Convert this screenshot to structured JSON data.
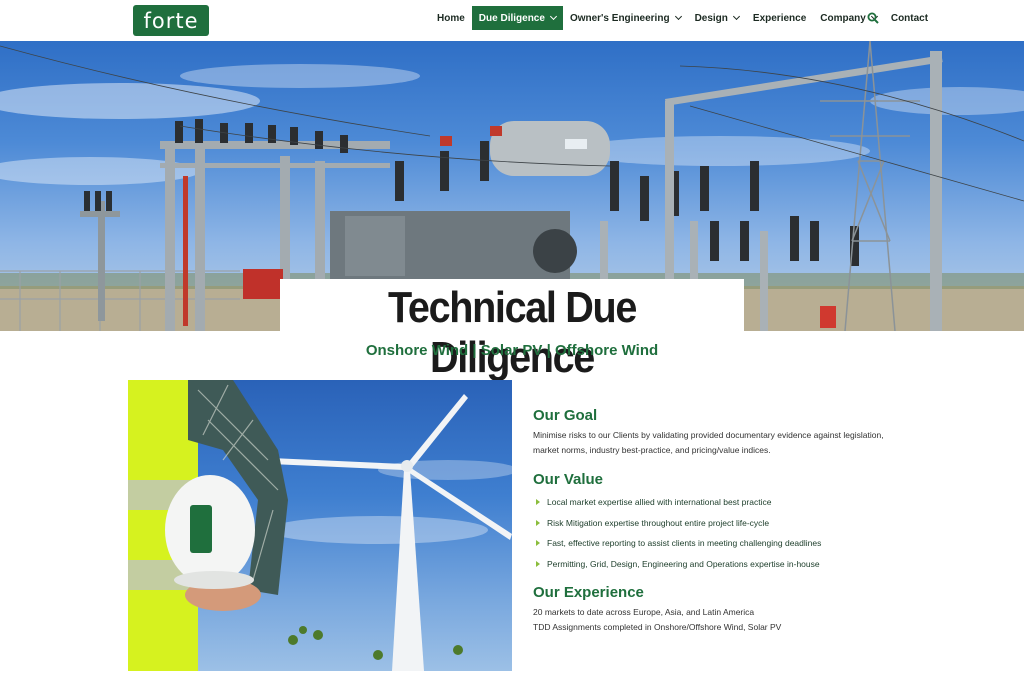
{
  "header": {
    "logo_text": "forte",
    "nav": [
      {
        "label": "Home",
        "dropdown": false,
        "active": false
      },
      {
        "label": "Due Diligence",
        "dropdown": true,
        "active": true
      },
      {
        "label": "Owner's Engineering",
        "dropdown": true,
        "active": false
      },
      {
        "label": "Design",
        "dropdown": true,
        "active": false
      },
      {
        "label": "Experience",
        "dropdown": false,
        "active": false
      },
      {
        "label": "Company",
        "dropdown": true,
        "active": false
      },
      {
        "label": "Contact",
        "dropdown": false,
        "active": false
      }
    ],
    "search_icon": "search-icon"
  },
  "hero": {
    "title": "Technical Due Diligence",
    "subtitle": "Onshore Wind | Solar PV | Offshore Wind",
    "image_subject": "electrical-substation"
  },
  "photo": {
    "image_subject": "worker-holding-helmet-wind-turbine",
    "helmet_logo_text": "forte"
  },
  "sections": {
    "goal": {
      "title": "Our Goal",
      "text": "Minimise risks to our Clients by validating provided documentary evidence against legislation, market norms, industry best-practice, and pricing/value indices."
    },
    "value": {
      "title": "Our Value",
      "items": [
        "Local market expertise allied with international best practice",
        "Risk Mitigation expertise throughout entire project life-cycle",
        "Fast, effective reporting to assist clients in meeting challenging deadlines",
        "Permitting, Grid, Design, Engineering and Operations expertise in-house"
      ]
    },
    "experience": {
      "title": "Our Experience",
      "lines": [
        "20 markets to date across Europe, Asia, and Latin America",
        "TDD Assignments completed in Onshore/Offshore Wind, Solar PV"
      ]
    }
  },
  "colors": {
    "brand_green": "#1f6f3d",
    "bullet_green": "#8bbd3c",
    "sky_blue": "#3f7fd0",
    "vest_yellow": "#d6f21f"
  }
}
